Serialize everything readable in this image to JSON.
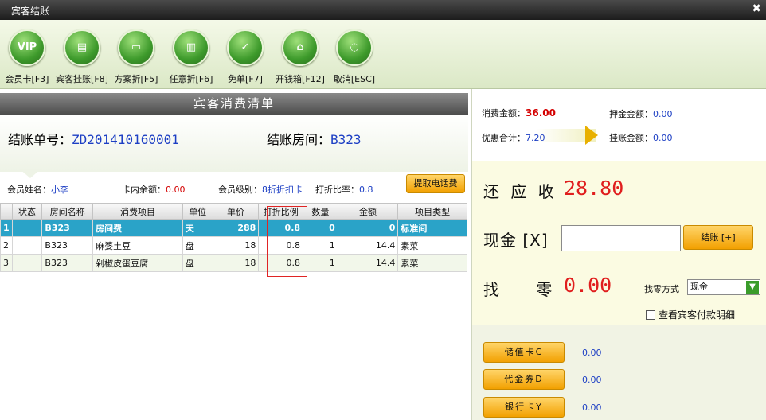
{
  "window": {
    "title": "宾客结账",
    "close_glyph": "✖"
  },
  "toolbar": {
    "buttons": [
      {
        "label": "会员卡[F3]",
        "icon": "vip-icon",
        "glyph": "VIP"
      },
      {
        "label": "宾客挂账[F8]",
        "icon": "vip-document-icon",
        "glyph": "▤"
      },
      {
        "label": "方案折[F5]",
        "icon": "window-icon",
        "glyph": "▭"
      },
      {
        "label": "任意折[F6]",
        "icon": "scroll-icon",
        "glyph": "▥"
      },
      {
        "label": "免单[F7]",
        "icon": "clipboard-check-icon",
        "glyph": "✓"
      },
      {
        "label": "开钱箱[F12]",
        "icon": "cash-box-icon",
        "glyph": "⌂"
      },
      {
        "label": "取消[ESC]",
        "icon": "dotted-circle-icon",
        "glyph": "◌"
      }
    ]
  },
  "list": {
    "header": "宾客消费清单",
    "bill_no_label": "结账单号：",
    "bill_no": "ZD201410160001",
    "room_label": "结账房间：",
    "room": "B323",
    "member_name_label": "会员姓名：",
    "member_name": "小李",
    "card_balance_label": "卡内余额：",
    "card_balance": "0.00",
    "member_level_label": "会员级别：",
    "member_level": "8折折扣卡",
    "discount_rate_label": "打折比率：",
    "discount_rate": "0.8",
    "phone_fee_button": "提取电话费",
    "columns": [
      "",
      "状态",
      "房间名称",
      "消费项目",
      "单位",
      "单价",
      "打折比例",
      "数量",
      "金额",
      "项目类型"
    ],
    "rows": [
      [
        "1",
        "",
        "B323",
        "房间费",
        "天",
        "288",
        "0.8",
        "0",
        "0",
        "标准间"
      ],
      [
        "2",
        "",
        "B323",
        "麻婆土豆",
        "盘",
        "18",
        "0.8",
        "1",
        "14.4",
        "素菜"
      ],
      [
        "3",
        "",
        "B323",
        "剁椒皮蛋豆腐",
        "盘",
        "18",
        "0.8",
        "1",
        "14.4",
        "素菜"
      ]
    ]
  },
  "summary": {
    "consume_label": "消费金额：",
    "consume": "36.00",
    "deposit_label": "押金金额：",
    "deposit": "0.00",
    "discount_label": "优惠合计：",
    "discount": "7.20",
    "onaccount_label": "挂账金额：",
    "onaccount": "0.00"
  },
  "payment": {
    "due_label": "还 应 收",
    "due": "28.80",
    "cash_label": "现金 [X]",
    "cash_value": "",
    "pay_button": "结账 [+]",
    "change_label": "找  零",
    "change": "0.00",
    "change_method_label": "找零方式",
    "change_method": "现金",
    "detail_checkbox": "查看宾客付款明细"
  },
  "cards": [
    {
      "label": "储值卡C",
      "value": "0.00"
    },
    {
      "label": "代金券D",
      "value": "0.00"
    },
    {
      "label": "银行卡Y",
      "value": "0.00"
    }
  ],
  "colors": {
    "accent_green": "#3d9a2b",
    "selected_row": "#2aa3c8",
    "amount_red": "#e01e1e",
    "value_blue": "#1d3fc4",
    "button_orange": "#f2a000"
  }
}
